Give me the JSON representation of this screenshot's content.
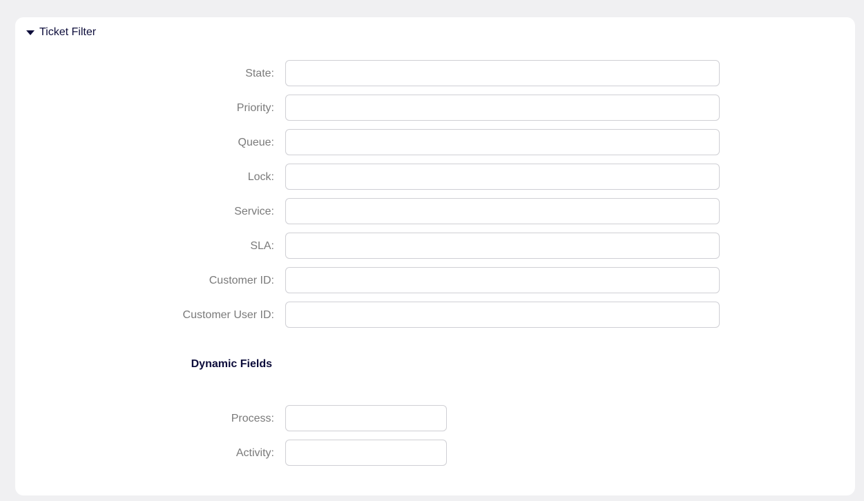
{
  "panel": {
    "title": "Ticket Filter"
  },
  "fields": [
    {
      "label": "State:",
      "value": ""
    },
    {
      "label": "Priority:",
      "value": ""
    },
    {
      "label": "Queue:",
      "value": ""
    },
    {
      "label": "Lock:",
      "value": ""
    },
    {
      "label": "Service:",
      "value": ""
    },
    {
      "label": "SLA:",
      "value": ""
    },
    {
      "label": "Customer ID:",
      "value": ""
    },
    {
      "label": "Customer User ID:",
      "value": ""
    }
  ],
  "dynamic": {
    "heading": "Dynamic Fields",
    "fields": [
      {
        "label": "Process:",
        "value": ""
      },
      {
        "label": "Activity:",
        "value": ""
      }
    ]
  }
}
